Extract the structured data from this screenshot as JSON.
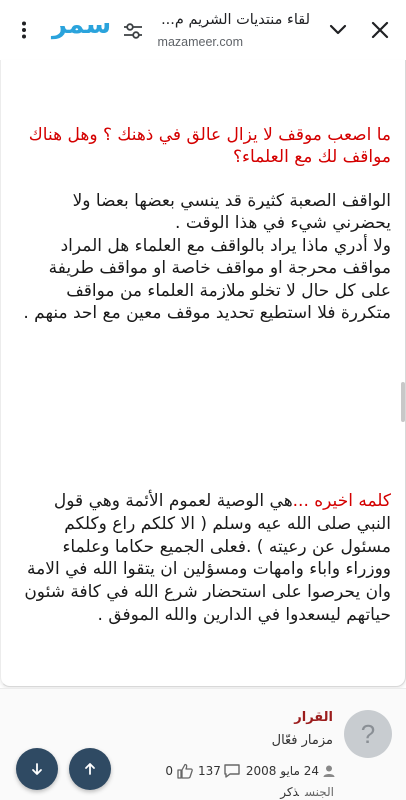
{
  "browser": {
    "page_title": "لقاء منتديات الشريم م...",
    "url": "mazameer.com",
    "logo_text": "سمر",
    "logo_color": "#2aa3dc"
  },
  "post": {
    "question": "ما اصعب موقف لا يزال عالق في ذهنك ؟ وهل هناك مواقف لك مع العلماء؟",
    "answer_lines": [
      "الواقف الصعبة كثيرة قد ينسي بعضها بعضا ولا يحضرني شيء في هذا الوقت .",
      "ولا أدري ماذا يراد بالواقف مع العلماء هل المراد مواقف محرجة او مواقف خاصة او مواقف طريفة على كل حال لا تخلو ملازمة العلماء من مواقف متكررة فلا استطيع تحديد موقف معين مع احد منهم ."
    ],
    "closing_label": "كلمه اخيره ...",
    "closing_text": "هي الوصية لعموم الأئمة وهي قول النبي صلى الله عيه وسلم ( الا كلكم راع وكلكم مسئول عن رعيته ) .فعلى الجميع حكاما وعلماء ووزراء واباء وامهات ومسؤلين ان يتقوا الله في الامة وان يحرصوا على استحضار شرع الله في كافة شئون حياتهم ليسعدوا في الدارين والله الموفق ."
  },
  "author": {
    "avatar_symbol": "?",
    "name": "القرار",
    "title": "مزمار فعّال",
    "join_date": "24 مايو 2008",
    "posts": "137",
    "likes": "0",
    "gender_label": "الجنس",
    "gender_value": "ذكر"
  },
  "colors": {
    "question_red": "#d40000",
    "fab_navy": "#2f4a63",
    "author_name": "#9b1c1c"
  }
}
